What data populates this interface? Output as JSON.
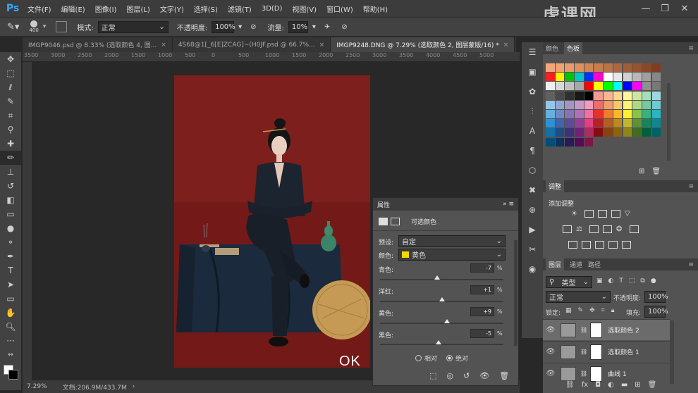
{
  "app": {
    "logo": "Ps"
  },
  "menu": [
    "文件(F)",
    "编辑(E)",
    "图像(I)",
    "图层(L)",
    "文字(Y)",
    "选择(S)",
    "滤镜(T)",
    "3D(D)",
    "视图(V)",
    "窗口(W)",
    "帮助(H)"
  ],
  "options": {
    "brush_size": "400",
    "mode_label": "模式:",
    "mode_value": "正常",
    "opacity_label": "不透明度:",
    "opacity_value": "100%",
    "flow_label": "流量:",
    "flow_value": "10%"
  },
  "watermark": "虎课网",
  "tabs": [
    {
      "label": "IMGP9046.psd @ 8.33% (选取颜色 4, 图..."
    },
    {
      "label": "4S68@1[_6[E]ZCAG]~(H0JF.psd @ 66.7%..."
    },
    {
      "label": "IMGP9248.DNG @ 7.29% (选取颜色 2, 图层蒙版/16) *"
    }
  ],
  "ruler_ticks": [
    "3500",
    "3000",
    "2500",
    "2000",
    "1500",
    "1000",
    "500",
    "0",
    "500",
    "1000",
    "1500",
    "2000",
    "2500",
    "3000",
    "3500",
    "4000",
    "4500",
    "5000"
  ],
  "status": {
    "zoom": "7.29%",
    "doc": "文档:206.9M/433.7M"
  },
  "caption": "OK",
  "properties": {
    "title": "属性",
    "adjustment": "可选颜色",
    "preset_label": "预设:",
    "preset_value": "自定",
    "colors_label": "颜色:",
    "colors_value": "黄色",
    "sliders": [
      {
        "label": "青色:",
        "value": "-7",
        "unit": "%",
        "level": 0.465
      },
      {
        "label": "洋红:",
        "value": "+1",
        "unit": "%",
        "level": 0.505
      },
      {
        "label": "黄色:",
        "value": "+9",
        "unit": "%",
        "level": 0.545
      },
      {
        "label": "黑色:",
        "value": "-5",
        "unit": "%",
        "level": 0.475
      }
    ],
    "method_relative": "相对",
    "method_absolute": "绝对"
  },
  "swatches_panel": {
    "tab_color": "颜色",
    "tab_swatches": "色板"
  },
  "adjustments_panel": {
    "title": "调整",
    "add_label": "添加调整"
  },
  "layers_panel": {
    "tabs": [
      "图层",
      "通道",
      "路径"
    ],
    "filter_value": "类型",
    "blend_value": "正常",
    "opacity_label": "不透明度:",
    "opacity_value": "100%",
    "lock_label": "锁定:",
    "fill_label": "填充:",
    "fill_value": "100%",
    "layers": [
      {
        "name": "选取颜色 2",
        "selected": true
      },
      {
        "name": "选取颜色 1",
        "selected": false
      },
      {
        "name": "曲线 1",
        "selected": false
      }
    ]
  },
  "swatch_colors": [
    "#f4a77c",
    "#f2a270",
    "#e99a68",
    "#dd9060",
    "#d08658",
    "#c47c50",
    "#b87248",
    "#ac6840",
    "#a05e38",
    "#945430",
    "#884a28",
    "#7c4020",
    "#fb1e1e",
    "#fff200",
    "#00c600",
    "#00c6c6",
    "#0033ff",
    "#ff00cc",
    "#ffffff",
    "#e8e8e8",
    "#d0d0d0",
    "#b8b8b8",
    "#a0a0a0",
    "#888888",
    "#f0f0f0",
    "#d8d8d8",
    "#c0c0c0",
    "#a8a8a8",
    "#ff0000",
    "#ffff00",
    "#00ff00",
    "#00ffff",
    "#0000ff",
    "#ff00ff",
    "#909090",
    "#787878",
    "#606060",
    "#484848",
    "#303030",
    "#181818",
    "#000000",
    "#f29a94",
    "#f7b793",
    "#fbd78f",
    "#fff799",
    "#cde6a0",
    "#a9dcb9",
    "#9cd8e0",
    "#92c6ea",
    "#8fa7d4",
    "#a493c7",
    "#c598c7",
    "#f19ac2",
    "#ed6d69",
    "#f29c6c",
    "#f9c766",
    "#fff46f",
    "#afd87f",
    "#76c9a0",
    "#6ccbd5",
    "#64b0e0",
    "#6e89c4",
    "#8672b4",
    "#ad72b3",
    "#ee72a5",
    "#e8302a",
    "#ed7d2f",
    "#f7b82a",
    "#fff032",
    "#88c34a",
    "#3bb17d",
    "#29b5c3",
    "#2b93d3",
    "#3e66b0",
    "#5c4b9c",
    "#943e9a",
    "#e73d86",
    "#b32225",
    "#b55d24",
    "#bb8b1e",
    "#c2b62a",
    "#5d9335",
    "#15865b",
    "#0a8993",
    "#1071a4",
    "#1f4c89",
    "#3d307a",
    "#702276",
    "#ae2a63",
    "#860c10",
    "#874212",
    "#8a650e",
    "#8f8619",
    "#416c21",
    "#005f3d",
    "#006267",
    "#004f78",
    "#0c3262",
    "#271b58",
    "#510c56",
    "#801547"
  ]
}
